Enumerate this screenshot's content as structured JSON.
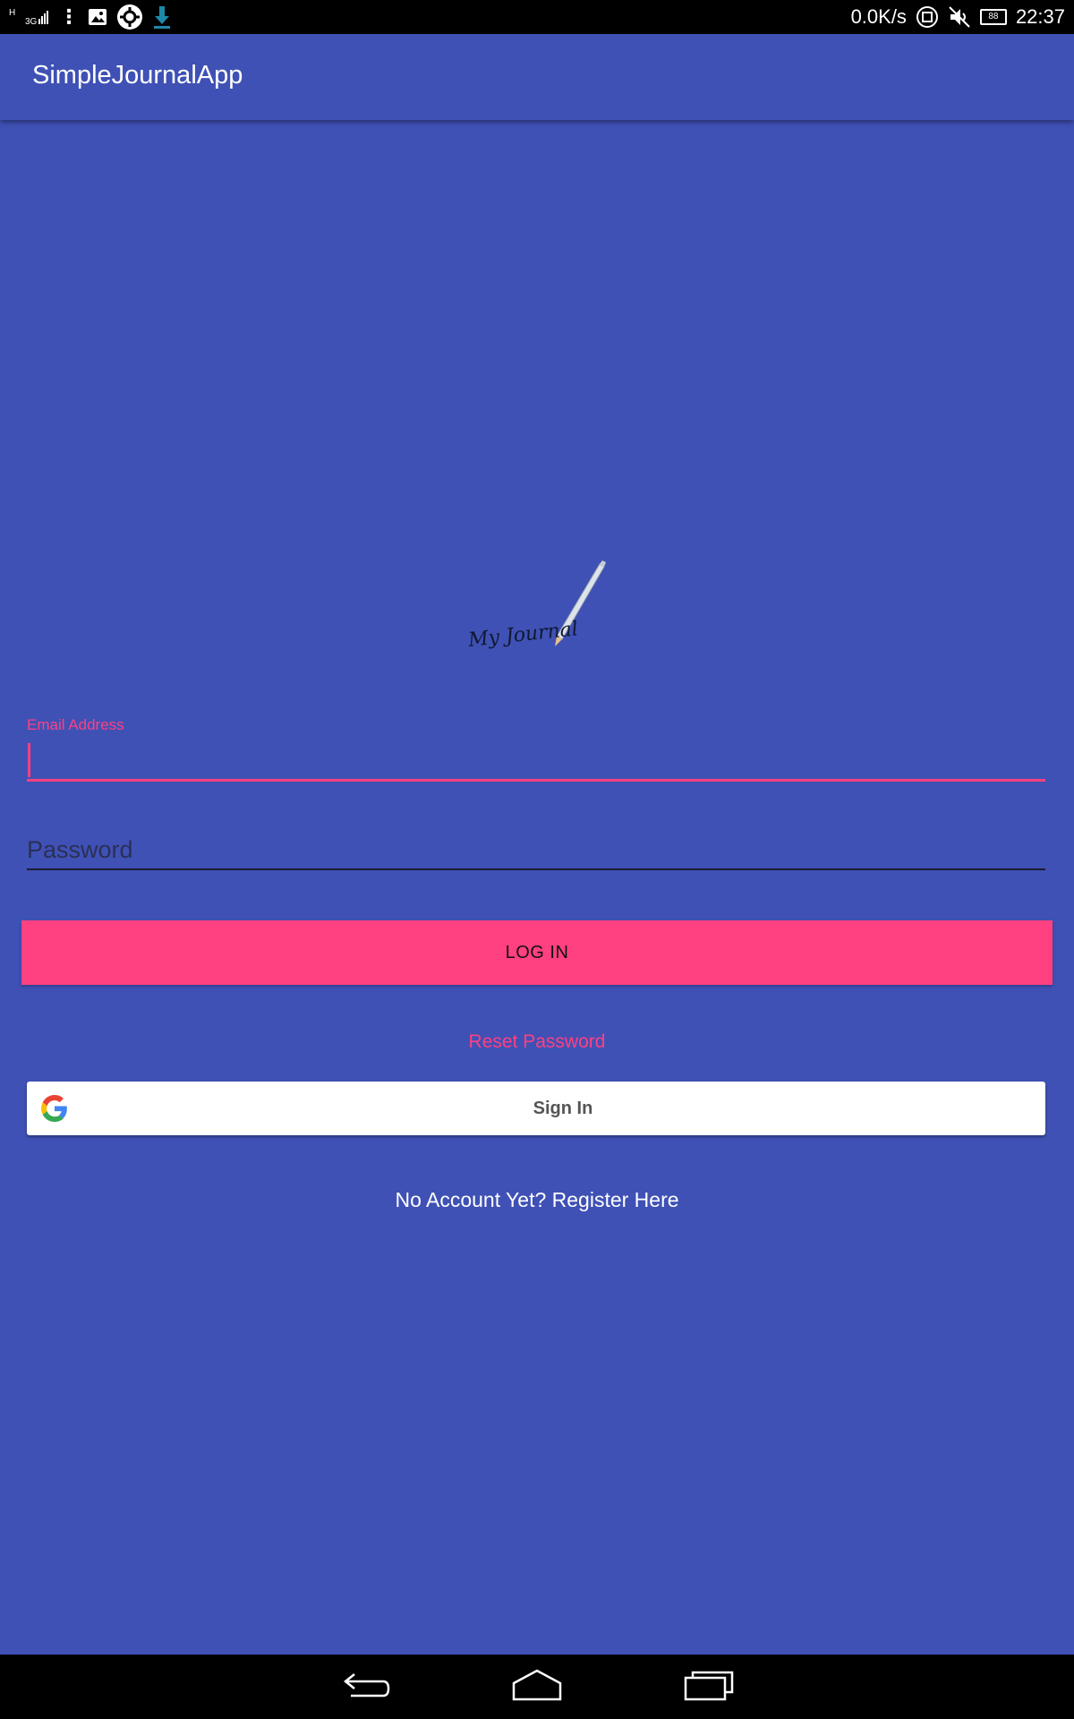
{
  "status_bar": {
    "network": "3G",
    "network_h": "H",
    "speed": "0.0K/s",
    "battery": "88",
    "time": "22:37"
  },
  "app_bar": {
    "title": "SimpleJournalApp"
  },
  "logo": {
    "text": "My Journal"
  },
  "form": {
    "email_label": "Email Address",
    "email_value": "",
    "password_placeholder": "Password",
    "login_label": "LOG IN",
    "reset_label": "Reset Password",
    "google_label": "Sign In",
    "register_label": "No Account Yet? Register Here"
  },
  "colors": {
    "primary": "#3F51B5",
    "accent": "#FF4081"
  },
  "icons": {
    "google": "google-g-icon",
    "back": "back-icon",
    "home": "home-icon",
    "recents": "recents-icon"
  }
}
